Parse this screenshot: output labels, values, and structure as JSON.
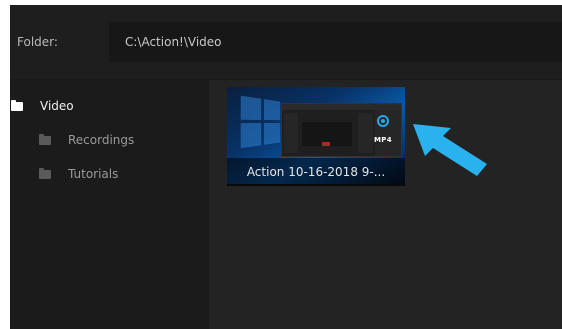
{
  "toolbar": {
    "folder_label": "Folder:",
    "folder_path": "C:\\Action!\\Video"
  },
  "sidebar": {
    "items": [
      {
        "label": "Video",
        "icon": "folder-icon",
        "selected": true
      },
      {
        "label": "Recordings",
        "icon": "folder-icon"
      },
      {
        "label": "Tutorials",
        "icon": "folder-icon"
      }
    ]
  },
  "content": {
    "items": [
      {
        "caption": "Action 10-16-2018 9-...",
        "format_badge": "MP4",
        "icon": "disc-icon"
      }
    ]
  },
  "annotation": {
    "icon": "arrow-icon",
    "color": "#29b2ee"
  },
  "colors": {
    "accent": "#29a5e8",
    "background": "#232323",
    "sidebar": "#1b1b1b"
  }
}
